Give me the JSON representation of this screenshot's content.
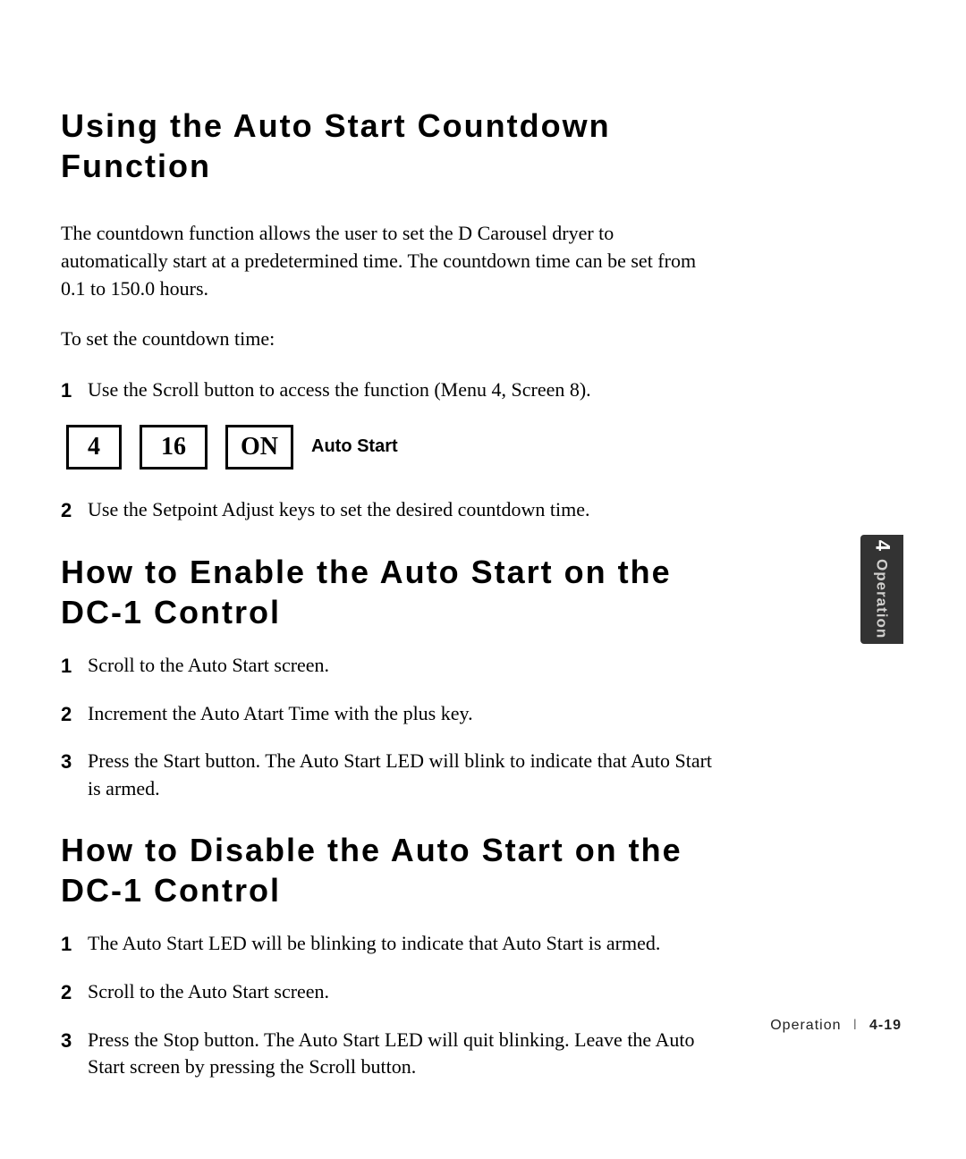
{
  "sections": [
    {
      "heading": "Using the Auto Start Countdown Function",
      "intro": "The countdown function allows the user to set the D Carousel dryer to automatically start at a predetermined time.  The countdown time can be set from 0.1 to 150.0 hours.",
      "lead": "To set the countdown time:",
      "steps": [
        {
          "num": "1",
          "text": "Use the Scroll button to access the function (Menu 4, Screen 8)."
        },
        {
          "num": "2",
          "text": " Use the Setpoint Adjust keys to set the desired countdown time."
        }
      ],
      "lcd": {
        "a": "4",
        "b": "16",
        "c": "ON",
        "label": "Auto Start"
      }
    },
    {
      "heading": "How to Enable the Auto Start on the DC-1 Control",
      "steps": [
        {
          "num": "1",
          "text": " Scroll to the Auto Start screen."
        },
        {
          "num": "2",
          "text": " Increment the Auto Atart Time with the plus key."
        },
        {
          "num": "3",
          "text": " Press the Start button. The Auto Start LED will blink to indicate that Auto Start is armed."
        }
      ]
    },
    {
      "heading": "How to Disable the Auto Start on the DC-1 Control",
      "steps": [
        {
          "num": "1",
          "text": " The Auto Start LED will be blinking to indicate that Auto Start is armed."
        },
        {
          "num": "2",
          "text": " Scroll to the Auto Start screen."
        },
        {
          "num": "3",
          "text": " Press the Stop button. The Auto Start LED will quit blinking. Leave the Auto Start screen by pressing the Scroll button."
        }
      ]
    }
  ],
  "tab": {
    "num": "4",
    "label": "Operation"
  },
  "footer": {
    "section": "Operation",
    "page": "4-19"
  }
}
